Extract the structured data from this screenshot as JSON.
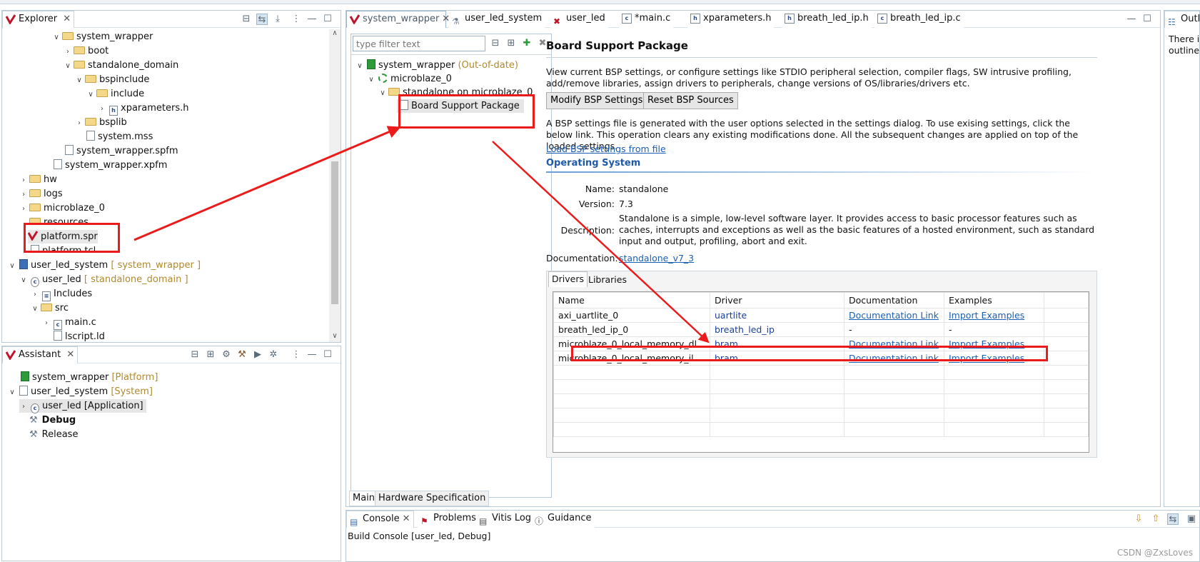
{
  "explorer": {
    "title": "Explorer",
    "rows": [
      {
        "label": "system_wrapper",
        "deco": ""
      },
      {
        "label": "boot",
        "deco": ""
      },
      {
        "label": "standalone_domain",
        "deco": ""
      },
      {
        "label": "bspinclude",
        "deco": ""
      },
      {
        "label": "include",
        "deco": ""
      },
      {
        "label": "xparameters.h",
        "deco": ""
      },
      {
        "label": "bsplib",
        "deco": ""
      },
      {
        "label": "system.mss",
        "deco": ""
      },
      {
        "label": "system_wrapper.spfm",
        "deco": ""
      },
      {
        "label": "system_wrapper.xpfm",
        "deco": ""
      },
      {
        "label": "hw",
        "deco": ""
      },
      {
        "label": "logs",
        "deco": ""
      },
      {
        "label": "microblaze_0",
        "deco": ""
      },
      {
        "label": "resources",
        "deco": ""
      },
      {
        "label": "platform.spr",
        "deco": ""
      },
      {
        "label": "platform.tcl",
        "deco": ""
      },
      {
        "label": "user_led_system",
        "deco": "[ system_wrapper ]"
      },
      {
        "label": "user_led",
        "deco": "[ standalone_domain ]"
      },
      {
        "label": "Includes",
        "deco": ""
      },
      {
        "label": "src",
        "deco": ""
      },
      {
        "label": "main.c",
        "deco": ""
      },
      {
        "label": "lscript.ld",
        "deco": ""
      }
    ]
  },
  "assistant": {
    "title": "Assistant",
    "rows": [
      {
        "label": "system_wrapper",
        "deco": "[Platform]"
      },
      {
        "label": "user_led_system",
        "deco": "[System]"
      },
      {
        "label": "user_led [Application]",
        "deco": ""
      },
      {
        "label": "Debug",
        "deco": ""
      },
      {
        "label": "Release",
        "deco": ""
      }
    ]
  },
  "editor_tabs": [
    "system_wrapper",
    "user_led_system",
    "user_led",
    "*main.c",
    "xparameters.h",
    "breath_led_ip.h",
    "breath_led_ip.c"
  ],
  "outline": {
    "title": "Outli",
    "text1": "There is",
    "text2": "outline."
  },
  "bsp_tree": {
    "filter_placeholder": "type filter text",
    "root": "system_wrapper",
    "root_deco": "(Out-of-date)",
    "cpu": "microblaze_0",
    "domain": "standalone on microblaze_0",
    "bsp": "Board Support Package"
  },
  "bsp": {
    "heading": "Board Support Package",
    "intro": "View current BSP settings, or configure settings like STDIO peripheral selection, compiler flags, SW intrusive profiling, add/remove libraries, assign drivers to peripherals, change versions of OS/libraries/drivers etc.",
    "modify_btn": "Modify BSP Settings...",
    "reset_btn": "Reset BSP Sources",
    "settings_text": "A BSP settings file is generated with the user options selected in the settings dialog. To use exising settings, click the below link. This operation clears any existing modifications done. All the subsequent changes are applied on top of the loaded settings.",
    "load_link": "Load BSP settings from file",
    "os_heading": "Operating System",
    "name_label": "Name:",
    "name_value": "standalone",
    "version_label": "Version:",
    "version_value": "7.3",
    "desc_label": "Description:",
    "desc_value": "Standalone is a simple, low-level software layer. It provides access to basic processor features such as caches, interrupts and exceptions as well as the basic features of a hosted environment, such as standard input and output, profiling, abort and exit.",
    "doc_label": "Documentation:",
    "doc_link": "standalone_v7_3",
    "tabs": [
      "Drivers",
      "Libraries"
    ],
    "columns": [
      "Name",
      "Driver",
      "Documentation",
      "Examples"
    ],
    "drivers": [
      {
        "name": "axi_uartlite_0",
        "driver": "uartlite",
        "doc": "Documentation Link",
        "ex": "Import Examples"
      },
      {
        "name": "breath_led_ip_0",
        "driver": "breath_led_ip",
        "doc": "-",
        "ex": "-"
      },
      {
        "name": "microblaze_0_local_memory_dl...",
        "driver": "bram",
        "doc": "Documentation Link",
        "ex": "Import Examples"
      },
      {
        "name": "microblaze_0_local_memory_il...",
        "driver": "bram",
        "doc": "Documentation Link",
        "ex": "Import Examples"
      }
    ]
  },
  "bottom_tabs": [
    "Main",
    "Hardware Specification"
  ],
  "console": {
    "tabs": [
      "Console",
      "Problems",
      "Vitis Log",
      "Guidance"
    ],
    "build_text": "Build Console [user_led, Debug]"
  },
  "watermark": "CSDN @ZxsLoves",
  "colors": {
    "annotation": "#ec1b1b",
    "link": "#1a5fb4",
    "decoration": "#b08a2e"
  }
}
